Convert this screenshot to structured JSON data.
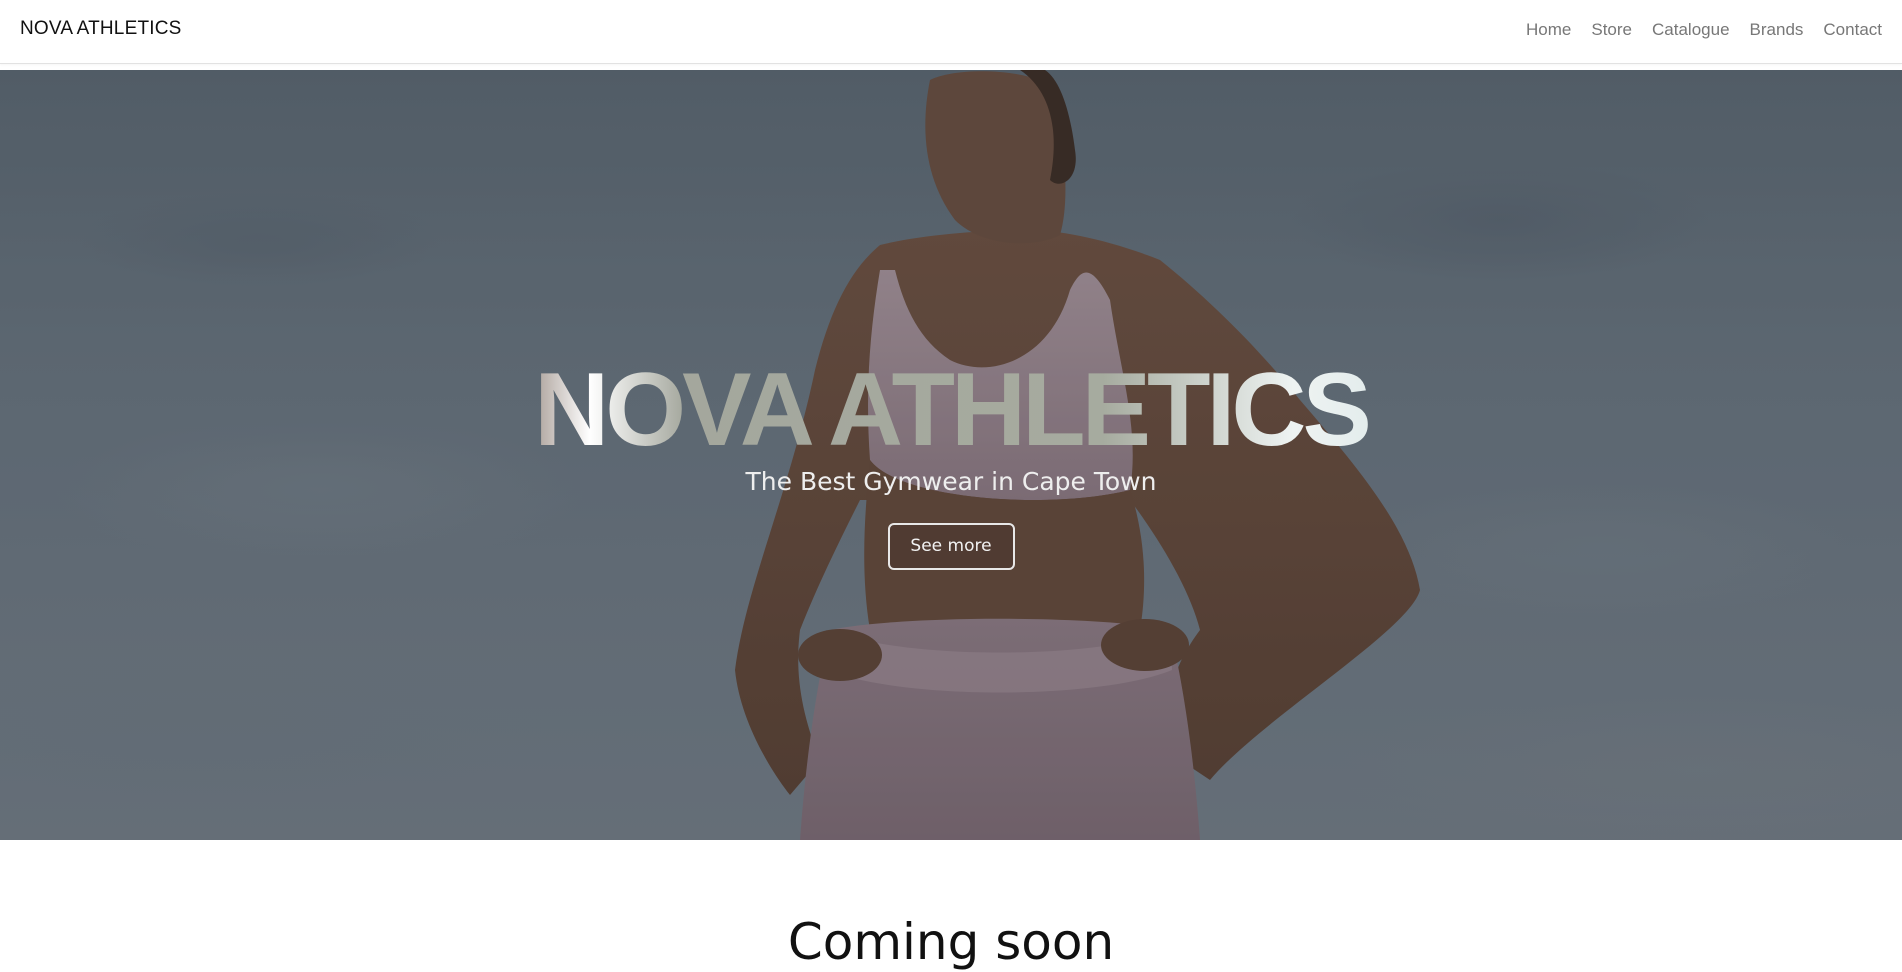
{
  "navbar": {
    "brand": "NOVA ATHLETICS",
    "links": [
      {
        "label": "Home"
      },
      {
        "label": "Store"
      },
      {
        "label": "Catalogue"
      },
      {
        "label": "Brands"
      },
      {
        "label": "Contact"
      }
    ]
  },
  "hero": {
    "title": "NOVA ATHLETICS",
    "subtitle": "The Best Gymwear in Cape Town",
    "cta_label": "See more"
  },
  "main": {
    "section_title": "Coming soon"
  },
  "colors": {
    "nav_link": "#777777",
    "brand_text": "#111111",
    "hero_sky": "#67727d",
    "outfit_mauve": "#9c8690"
  }
}
